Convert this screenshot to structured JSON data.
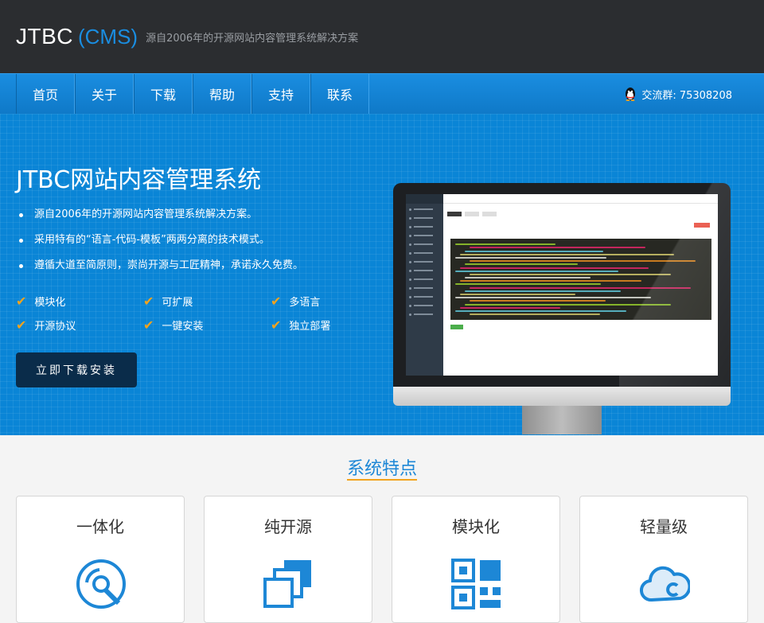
{
  "header": {
    "logo_main": "JTBC",
    "logo_cms": "(CMS)",
    "tagline": "源自2006年的开源网站内容管理系统解决方案"
  },
  "nav": {
    "items": [
      "首页",
      "关于",
      "下载",
      "帮助",
      "支持",
      "联系"
    ],
    "qq_group": "交流群: 75308208"
  },
  "hero": {
    "title": "JTBC网站内容管理系统",
    "bullets": [
      "源自2006年的开源网站内容管理系统解决方案。",
      "采用特有的“语言-代码-模板”两两分离的技术模式。",
      "遵循大道至简原则，崇尚开源与工匠精神，承诺永久免费。"
    ],
    "features": [
      "模块化",
      "可扩展",
      "多语言",
      "开源协议",
      "一键安装",
      "独立部署"
    ],
    "download_label": "立即下载安装"
  },
  "features_section": {
    "title": "系统特点",
    "cards": [
      {
        "title": "一体化",
        "icon": "disc-icon"
      },
      {
        "title": "纯开源",
        "icon": "layers-icon"
      },
      {
        "title": "模块化",
        "icon": "qrcode-icon"
      },
      {
        "title": "轻量级",
        "icon": "cloud-icon"
      }
    ]
  },
  "colors": {
    "accent": "#1a8de0",
    "hero_bg": "#0a85d6",
    "header_bg": "#2b2d30",
    "check": "#f2a31e"
  }
}
